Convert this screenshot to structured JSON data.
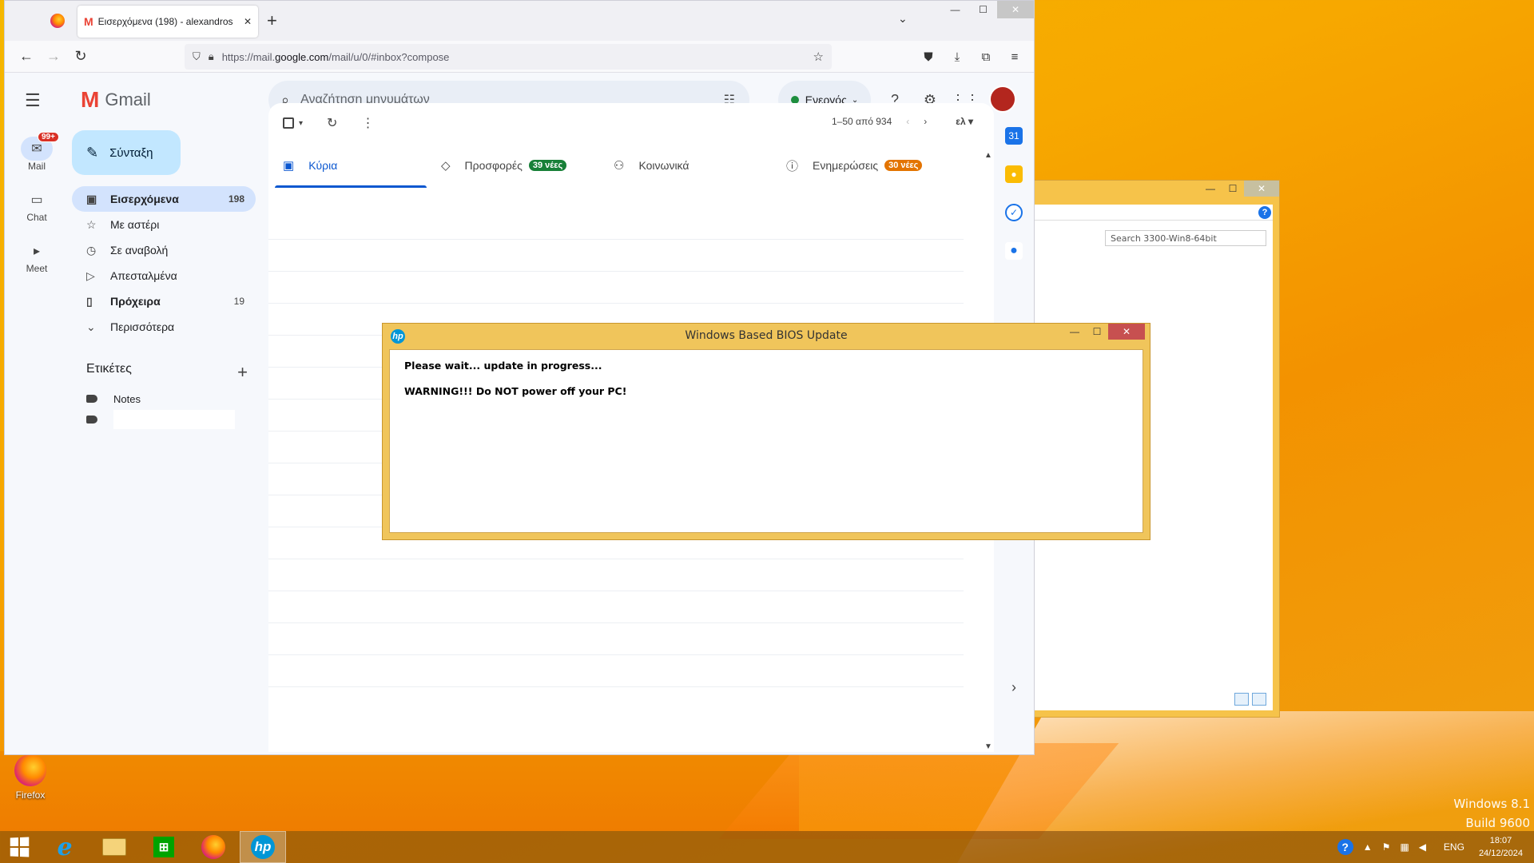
{
  "desktop": {
    "watermark": [
      "Windows 8.1",
      "Build 9600"
    ],
    "icons": [
      {
        "label": "Firefox",
        "icon": "firefox-icon"
      }
    ]
  },
  "taskbar": {
    "items": [
      "start-icon",
      "internet-explorer-icon",
      "file-explorer-icon",
      "store-icon",
      "firefox-icon",
      "hp-bios-icon"
    ],
    "tray": {
      "language": "ENG",
      "time": "18:07",
      "date": "24/12/2024"
    }
  },
  "explorer": {
    "search_placeholder": "Search 3300-Win8-64bit"
  },
  "firefox": {
    "tab_title": "Εισερχόμενα (198) - alexandros",
    "url_prefix": "https://mail.",
    "url_host": "google.com",
    "url_path": "/mail/u/0/#inbox?compose"
  },
  "gmail": {
    "brand": "Gmail",
    "search_placeholder": "Αναζήτηση μηνυμάτων",
    "status": "Ενεργός",
    "rail": [
      {
        "label": "Mail",
        "badge": "99+",
        "icon": "mail-icon"
      },
      {
        "label": "Chat",
        "icon": "chat-icon"
      },
      {
        "label": "Meet",
        "icon": "video-icon"
      }
    ],
    "compose": "Σύνταξη",
    "nav": [
      {
        "label": "Εισερχόμενα",
        "count": "198",
        "icon": "inbox-icon"
      },
      {
        "label": "Με αστέρι",
        "count": "",
        "icon": "star-icon"
      },
      {
        "label": "Σε αναβολή",
        "count": "",
        "icon": "clock-icon"
      },
      {
        "label": "Απεσταλμένα",
        "count": "",
        "icon": "send-icon"
      },
      {
        "label": "Πρόχειρα",
        "count": "19",
        "icon": "draft-icon"
      },
      {
        "label": "Περισσότερα",
        "count": "",
        "icon": "chevron-down-icon"
      }
    ],
    "labels_header": "Ετικέτες",
    "labels": [
      "Notes",
      ""
    ],
    "pager": "1–50 από 934",
    "input_lang": "ελ",
    "tabs": [
      {
        "label": "Κύρια",
        "badge": ""
      },
      {
        "label": "Προσφορές",
        "badge": "39 νέες",
        "badge_color": "#188038"
      },
      {
        "label": "Κοινωνικά",
        "badge": ""
      },
      {
        "label": "Ενημερώσεις",
        "badge": "30 νέες",
        "badge_color": "#e37400"
      }
    ]
  },
  "bios_dialog": {
    "title": "Windows Based BIOS Update",
    "line1": "Please wait... update in progress...",
    "line2": "WARNING!!! Do NOT power off your PC!"
  }
}
